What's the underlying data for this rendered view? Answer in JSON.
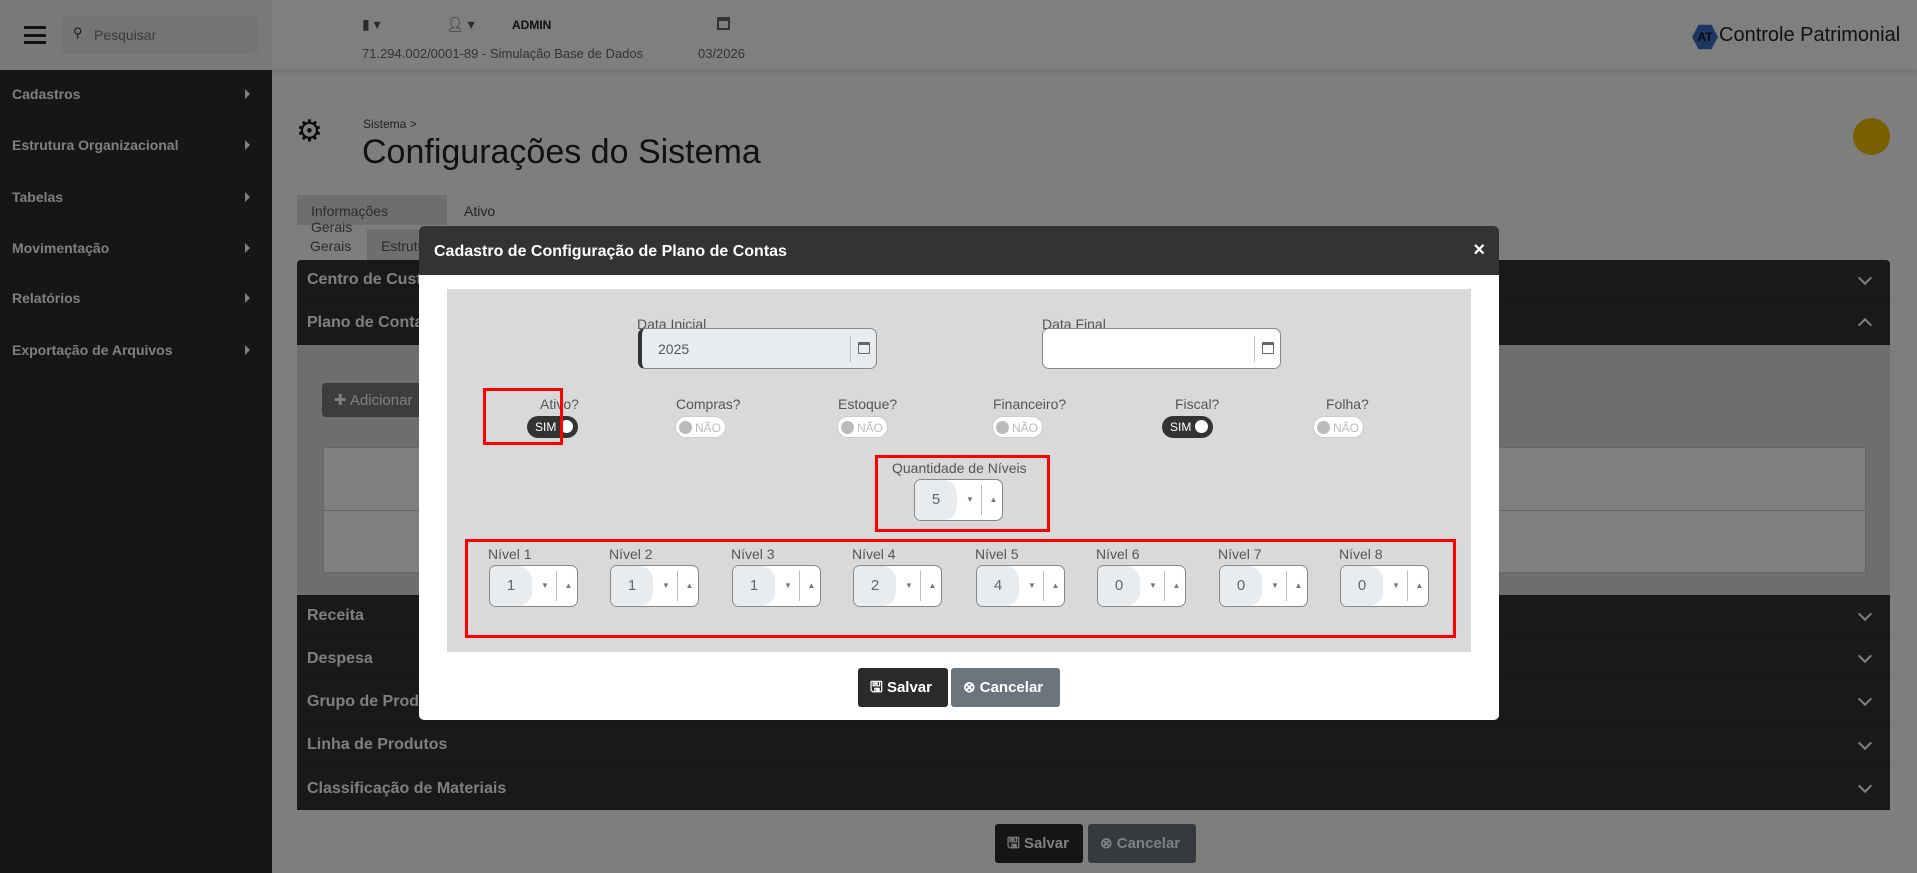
{
  "header": {
    "search_placeholder": "Pesquisar",
    "user": "ADMIN",
    "company": "71.294.002/0001-89 - Simulação Base de Dados",
    "period": "03/2026",
    "app_name": "Controle Patrimonial",
    "logo_text": "AT"
  },
  "sidebar": {
    "items": [
      {
        "label": "Cadastros"
      },
      {
        "label": "Estrutura Organizacional"
      },
      {
        "label": "Tabelas"
      },
      {
        "label": "Movimentação"
      },
      {
        "label": "Relatórios"
      },
      {
        "label": "Exportação de Arquivos"
      }
    ]
  },
  "page": {
    "breadcrumb": "Sistema",
    "breadcrumb_sep": ">",
    "title": "Configurações do Sistema",
    "tabs": [
      {
        "label": "Informações Gerais"
      },
      {
        "label": "Ativo"
      }
    ],
    "subtabs": [
      {
        "label": "Gerais"
      },
      {
        "label": "Estrutura"
      }
    ],
    "add_button": "Adicionar",
    "accordion": [
      {
        "label": "Centro de Custo",
        "expanded": false
      },
      {
        "label": "Plano de Contas",
        "expanded": true
      },
      {
        "label": "Receita",
        "expanded": false
      },
      {
        "label": "Despesa",
        "expanded": false
      },
      {
        "label": "Grupo de Produtos",
        "expanded": false
      },
      {
        "label": "Linha de Produtos",
        "expanded": false
      },
      {
        "label": "Classificação de Materiais",
        "expanded": false
      }
    ],
    "save": "Salvar",
    "cancel": "Cancelar"
  },
  "modal": {
    "title": "Cadastro de Configuração de Plano de Contas",
    "close": "×",
    "data_inicial": {
      "label": "Data Inicial",
      "value": "2025"
    },
    "data_final": {
      "label": "Data Final",
      "value": ""
    },
    "toggles": [
      {
        "label": "Ativo?",
        "value": "SIM",
        "on": true
      },
      {
        "label": "Compras?",
        "value": "NÃO",
        "on": false
      },
      {
        "label": "Estoque?",
        "value": "NÃO",
        "on": false
      },
      {
        "label": "Financeiro?",
        "value": "NÃO",
        "on": false
      },
      {
        "label": "Fiscal?",
        "value": "SIM",
        "on": true
      },
      {
        "label": "Folha?",
        "value": "NÃO",
        "on": false
      }
    ],
    "qtd_niveis": {
      "label": "Quantidade de Níveis",
      "value": "5"
    },
    "niveis": [
      {
        "label": "Nível 1",
        "value": "1"
      },
      {
        "label": "Nível 2",
        "value": "1"
      },
      {
        "label": "Nível 3",
        "value": "1"
      },
      {
        "label": "Nível 4",
        "value": "2"
      },
      {
        "label": "Nível 5",
        "value": "4"
      },
      {
        "label": "Nível 6",
        "value": "0"
      },
      {
        "label": "Nível 7",
        "value": "0"
      },
      {
        "label": "Nível 8",
        "value": "0"
      }
    ],
    "save": "Salvar",
    "cancel": "Cancelar"
  },
  "colors": {
    "accent": "#333333",
    "highlight": "#ff0000",
    "logo": "#3a6fc4",
    "pdf_button": "#f2c200"
  }
}
